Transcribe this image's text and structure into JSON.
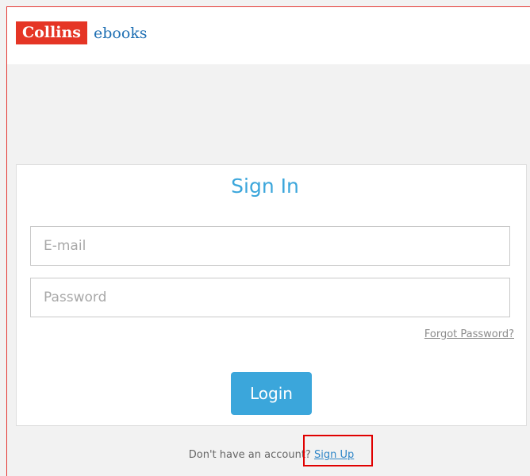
{
  "header": {
    "logo_brand": "Collins",
    "logo_product": "ebooks"
  },
  "signin": {
    "title": "Sign In",
    "email_placeholder": "E-mail",
    "password_placeholder": "Password",
    "forgot_label": "Forgot Password?",
    "login_label": "Login",
    "no_account_text": "Don't have an account?",
    "signup_label": "Sign Up"
  },
  "colors": {
    "brand_red": "#e53525",
    "accent_blue": "#3ba6db",
    "link_blue": "#2f86c7",
    "highlight_red": "#e00000"
  }
}
